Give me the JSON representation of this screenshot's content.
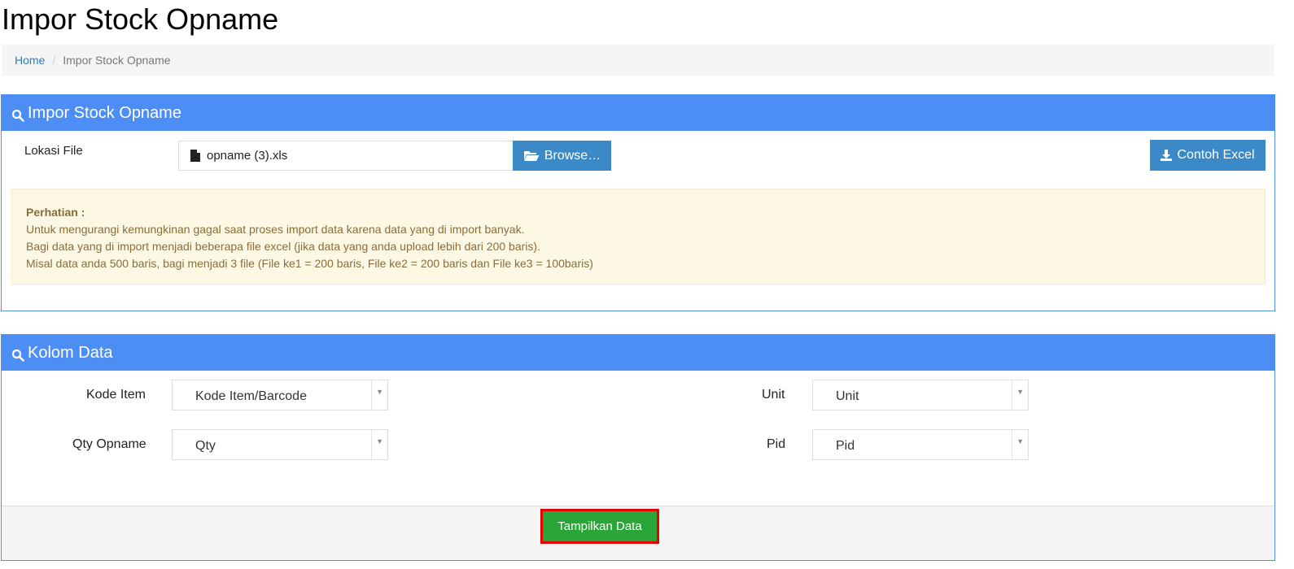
{
  "page": {
    "title": "Impor Stock Opname"
  },
  "breadcrumb": {
    "home": "Home",
    "separator": "/",
    "current": "Impor Stock Opname"
  },
  "import_panel": {
    "title": "Impor Stock Opname",
    "file_label": "Lokasi File",
    "file_name": "opname (3).xls",
    "browse_label": "Browse…",
    "contoh_label": "Contoh Excel",
    "alert": {
      "title": "Perhatian :",
      "lines": [
        "Untuk mengurangi kemungkinan gagal saat proses import data karena data yang di import banyak.",
        "Bagi data yang di import menjadi beberapa file excel (jika data yang anda upload lebih dari 200 baris).",
        "Misal data anda 500 baris, bagi menjadi 3 file (File ke1 = 200 baris, File ke2 = 200 baris dan File ke3 = 100baris)"
      ]
    }
  },
  "kolom_panel": {
    "title": "Kolom Data",
    "fields": [
      {
        "label": "Kode Item",
        "value": "Kode Item/Barcode"
      },
      {
        "label": "Unit",
        "value": "Unit"
      },
      {
        "label": "Qty Opname",
        "value": "Qty"
      },
      {
        "label": "Pid",
        "value": "Pid"
      }
    ],
    "submit_label": "Tampilkan Data"
  },
  "colors": {
    "panel_header": "#4d8ef5",
    "button_primary": "#3c89c8",
    "button_success": "#2aa538",
    "highlight_border": "#e60000",
    "alert_bg": "#fcf8e3",
    "alert_text": "#8a6d3b"
  },
  "icons": {
    "panel_header": "search-icon",
    "file": "file-icon",
    "browse": "folder-open-icon",
    "download": "download-icon",
    "select_arrow": "caret-down-icon"
  }
}
